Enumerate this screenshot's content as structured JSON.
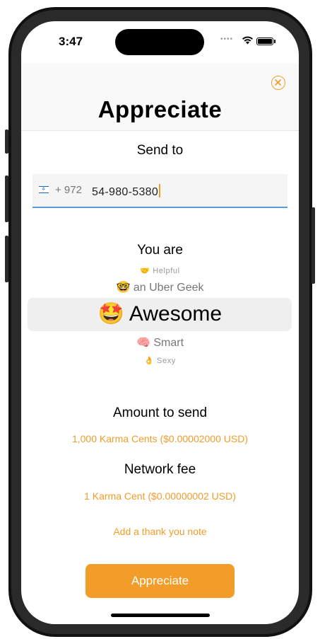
{
  "status_bar": {
    "time": "3:47",
    "signal": "••••"
  },
  "header": {
    "title": "Appreciate"
  },
  "send_to": {
    "label": "Send to",
    "flag_symbol": "✡",
    "country_code": "+ 972",
    "phone_number": "54-980-5380"
  },
  "you_are": {
    "label": "You are",
    "options": [
      {
        "emoji": "🤝",
        "label": "Helpful"
      },
      {
        "emoji": "🤓",
        "label": "an Uber Geek"
      },
      {
        "emoji": "🤩",
        "label": "Awesome"
      },
      {
        "emoji": "🧠",
        "label": "Smart"
      },
      {
        "emoji": "👌",
        "label": "Sexy"
      }
    ],
    "selected": "Awesome"
  },
  "amount": {
    "label": "Amount to send",
    "value": "1,000 Karma Cents ($0.00002000 USD)"
  },
  "fee": {
    "label": "Network fee",
    "value": "1 Karma Cent ($0.00000002 USD)"
  },
  "note_link": "Add a thank you note",
  "submit_label": "Appreciate",
  "colors": {
    "accent": "#f29d29",
    "input_underline": "#5b9bd5",
    "selected_row_bg": "#efefef"
  }
}
